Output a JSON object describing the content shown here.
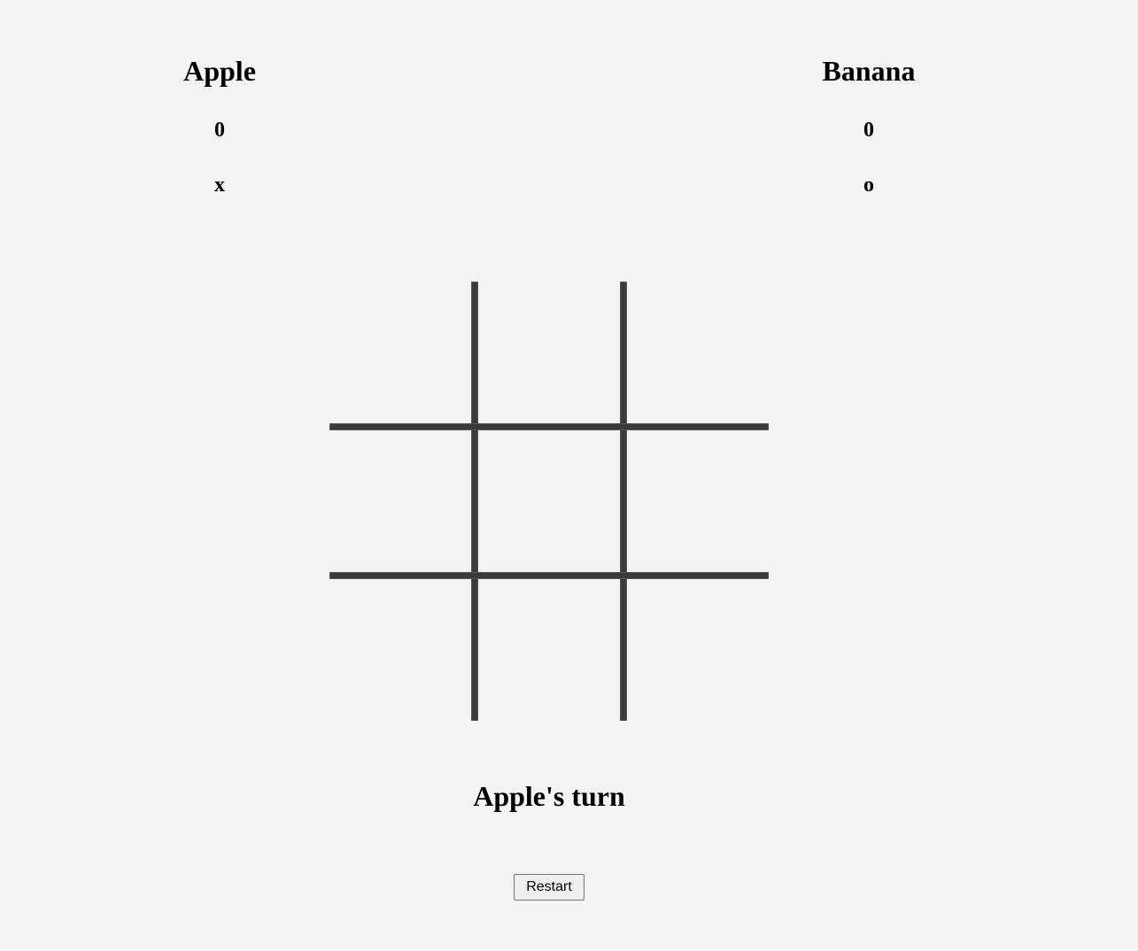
{
  "players": [
    {
      "name": "Apple",
      "score": "0",
      "symbol": "x"
    },
    {
      "name": "Banana",
      "score": "0",
      "symbol": "o"
    }
  ],
  "board": {
    "cells": [
      "",
      "",
      "",
      "",
      "",
      "",
      "",
      "",
      ""
    ]
  },
  "status": "Apple's turn",
  "restart_label": "Restart",
  "colors": {
    "background": "#f4f4f4",
    "grid_line": "#3a3a3a"
  }
}
